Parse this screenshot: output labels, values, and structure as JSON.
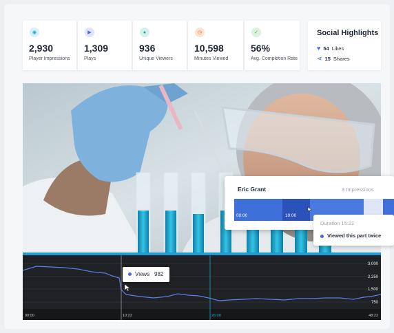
{
  "stats": [
    {
      "value": "2,930",
      "label": "Player Impressions",
      "icon": "eye-icon",
      "icon_glyph": "◉",
      "icon_bg": "#d6f0f6",
      "icon_color": "#1aa3c2"
    },
    {
      "value": "1,309",
      "label": "Plays",
      "icon": "play-icon",
      "icon_glyph": "▶",
      "icon_bg": "#dfe4fb",
      "icon_color": "#4b63d8"
    },
    {
      "value": "936",
      "label": "Unique Viewers",
      "icon": "user-icon",
      "icon_glyph": "●",
      "icon_bg": "#d5f1ee",
      "icon_color": "#1f9e93"
    },
    {
      "value": "10,598",
      "label": "Minutes Viewed",
      "icon": "clock-icon",
      "icon_glyph": "◷",
      "icon_bg": "#fde3d4",
      "icon_color": "#e8742c"
    },
    {
      "value": "56%",
      "label": "Avg. Completion Rate",
      "icon": "check-icon",
      "icon_glyph": "✓",
      "icon_bg": "#dcf2dc",
      "icon_color": "#3aa84a"
    }
  ],
  "social": {
    "title": "Social Highlights",
    "likes_count": "54",
    "likes_label": "Likes",
    "shares_count": "15",
    "shares_label": "Shares"
  },
  "viewer_popup": {
    "name": "Eric Grant",
    "impressions": "3 Impressions",
    "time_start": "00:00",
    "time_mark": "10:00"
  },
  "duration_tooltip": {
    "duration": "Duration 15:22",
    "note": "Viewed this part twice"
  },
  "views_tooltip": {
    "label": "Views",
    "value": "982"
  },
  "timeline": {
    "y_ticks": [
      "3,000",
      "2,250",
      "1,500",
      "750"
    ],
    "x_ticks": [
      "00:00",
      "10:22",
      "26:08",
      "48:22"
    ]
  },
  "colors": {
    "accent": "#3f6fd8",
    "accent_dark": "#2a52b8",
    "timeline_bg": "#1f2124",
    "line": "#5b7fe8"
  }
}
